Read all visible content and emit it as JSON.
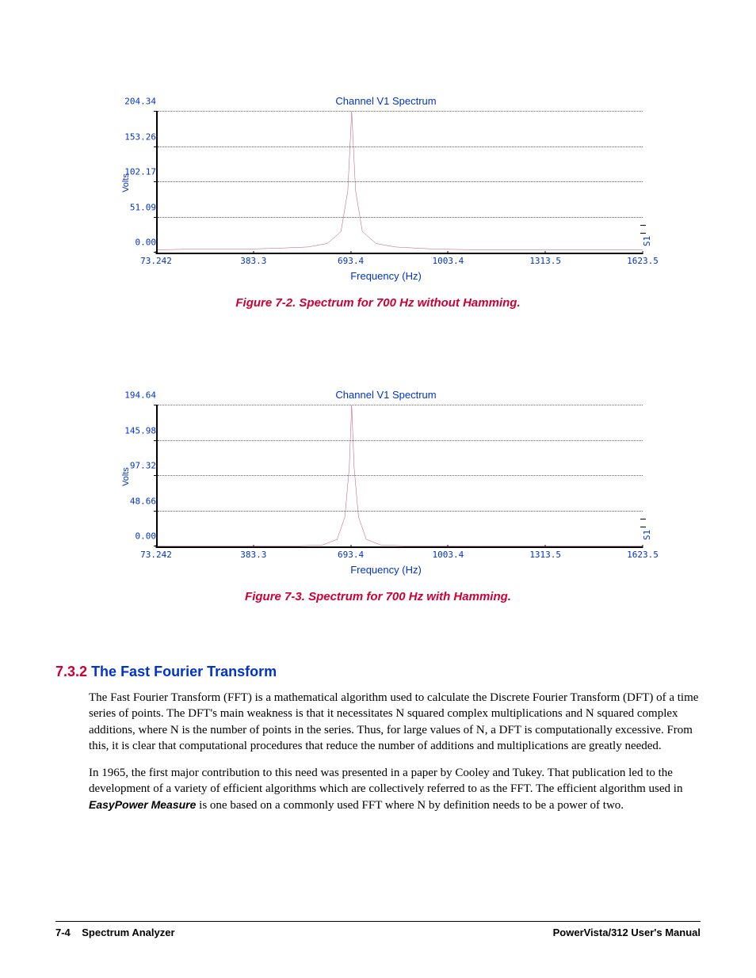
{
  "chart_data": [
    {
      "type": "line",
      "title": "Channel V1 Spectrum",
      "xlabel": "Frequency (Hz)",
      "ylabel": "Volts",
      "x_ticks": [
        "73.242",
        "383.3",
        "693.4",
        "1003.4",
        "1313.5",
        "1623.5"
      ],
      "y_ticks": [
        "0.00",
        "51.09",
        "102.17",
        "153.26",
        "204.34"
      ],
      "ylim": [
        0,
        204.34
      ],
      "xlim": [
        73.242,
        1623.5
      ],
      "legend": [
        "S1"
      ],
      "series": [
        {
          "name": "S1",
          "x": [
            73.242,
            200,
            350,
            450,
            550,
            620,
            660,
            680,
            693.4,
            706,
            730,
            770,
            840,
            950,
            1100,
            1300,
            1500,
            1623.5
          ],
          "y": [
            4,
            5,
            5,
            6,
            8,
            13,
            30,
            90,
            204.34,
            90,
            30,
            13,
            8,
            5,
            4,
            4,
            4,
            4
          ]
        }
      ],
      "caption": "Figure 7-2.  Spectrum for 700 Hz without Hamming."
    },
    {
      "type": "line",
      "title": "Channel V1 Spectrum",
      "xlabel": "Frequency (Hz)",
      "ylabel": "Volts",
      "x_ticks": [
        "73.242",
        "383.3",
        "693.4",
        "1003.4",
        "1313.5",
        "1623.5"
      ],
      "y_ticks": [
        "0.00",
        "48.66",
        "97.32",
        "145.98",
        "194.64"
      ],
      "ylim": [
        0,
        194.64
      ],
      "xlim": [
        73.242,
        1623.5
      ],
      "legend": [
        "S1"
      ],
      "series": [
        {
          "name": "S1",
          "x": [
            73.242,
            300,
            500,
            600,
            650,
            675,
            685,
            693.4,
            701,
            711,
            735,
            790,
            900,
            1100,
            1400,
            1623.5
          ],
          "y": [
            0.5,
            0.5,
            0.5,
            2,
            10,
            40,
            110,
            194.64,
            110,
            40,
            10,
            2,
            0.5,
            0.5,
            0.5,
            0.5
          ]
        }
      ],
      "caption": "Figure 7-3.  Spectrum for 700 Hz with Hamming."
    }
  ],
  "section": {
    "number": "7.3.2",
    "title": "The Fast Fourier Transform",
    "para1": "The Fast Fourier Transform (FFT) is a mathematical algorithm used to calculate the Discrete Fourier Transform (DFT) of a time series of points.  The DFT's main weakness is that it necessitates N squared complex multiplications and N squared complex additions, where N is the number of points in the series.  Thus, for large values of N, a DFT is computationally excessive.  From this, it is clear that computational procedures that reduce the number of additions and multiplications are greatly needed.",
    "para2_a": "In 1965, the first major contribution to this need was presented in a paper by Cooley and Tukey.  That publication led to the development of a variety of efficient algorithms which are collectively referred to as the FFT.  The efficient algorithm used in ",
    "para2_sw": "EasyPower Measure",
    "para2_b": " is one based on a commonly used FFT where N by definition needs to be a power of two."
  },
  "footer": {
    "left_page": "7-4",
    "left_title": "Spectrum Analyzer",
    "right": "PowerVista/312 User's Manual"
  }
}
